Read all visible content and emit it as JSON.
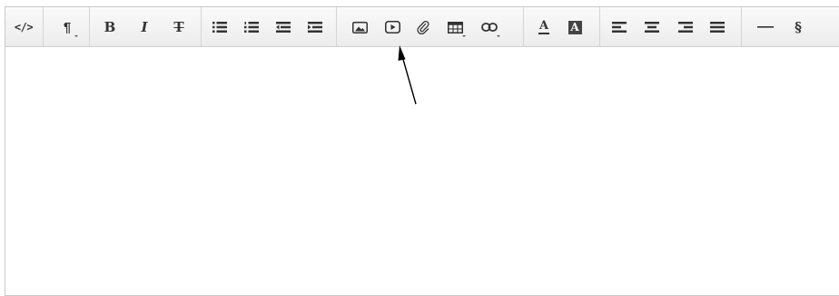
{
  "toolbar": {
    "code_view": "</>",
    "paragraph": "¶",
    "bold": "B",
    "italic": "I",
    "strikethrough": "T",
    "font_color": "A",
    "background_color": "A",
    "special_chars": "§",
    "buttons": [
      {
        "name": "code-view-button",
        "icon": "code-icon"
      },
      {
        "name": "paragraph-format-button",
        "icon": "paragraph-icon",
        "dropdown": true
      },
      {
        "name": "bold-button",
        "icon": "bold-icon"
      },
      {
        "name": "italic-button",
        "icon": "italic-icon"
      },
      {
        "name": "strikethrough-button",
        "icon": "strikethrough-icon"
      },
      {
        "name": "bulleted-list-button",
        "icon": "unordered-list-icon"
      },
      {
        "name": "numbered-list-button",
        "icon": "ordered-list-icon"
      },
      {
        "name": "outdent-button",
        "icon": "outdent-icon"
      },
      {
        "name": "indent-button",
        "icon": "indent-icon"
      },
      {
        "name": "insert-image-button",
        "icon": "image-icon"
      },
      {
        "name": "insert-video-button",
        "icon": "video-play-icon"
      },
      {
        "name": "insert-file-button",
        "icon": "paperclip-icon"
      },
      {
        "name": "insert-table-button",
        "icon": "table-icon",
        "dropdown": true
      },
      {
        "name": "insert-link-button",
        "icon": "link-icon",
        "dropdown": true
      },
      {
        "name": "font-color-button",
        "icon": "font-color-icon"
      },
      {
        "name": "background-color-button",
        "icon": "background-color-icon"
      },
      {
        "name": "align-left-button",
        "icon": "align-left-icon"
      },
      {
        "name": "align-center-button",
        "icon": "align-center-icon"
      },
      {
        "name": "align-right-button",
        "icon": "align-right-icon"
      },
      {
        "name": "align-justify-button",
        "icon": "align-justify-icon"
      },
      {
        "name": "horizontal-rule-button",
        "icon": "horizontal-line-icon"
      },
      {
        "name": "special-characters-button",
        "icon": "section-sign-icon"
      }
    ]
  },
  "annotation": {
    "icon": "arrow-icon",
    "points_to": "insert-video-button"
  },
  "colors": {
    "toolbar_bg": "#f1f1f1",
    "border": "#c9c9c9",
    "icon": "#333333",
    "arrow": "#000000"
  }
}
